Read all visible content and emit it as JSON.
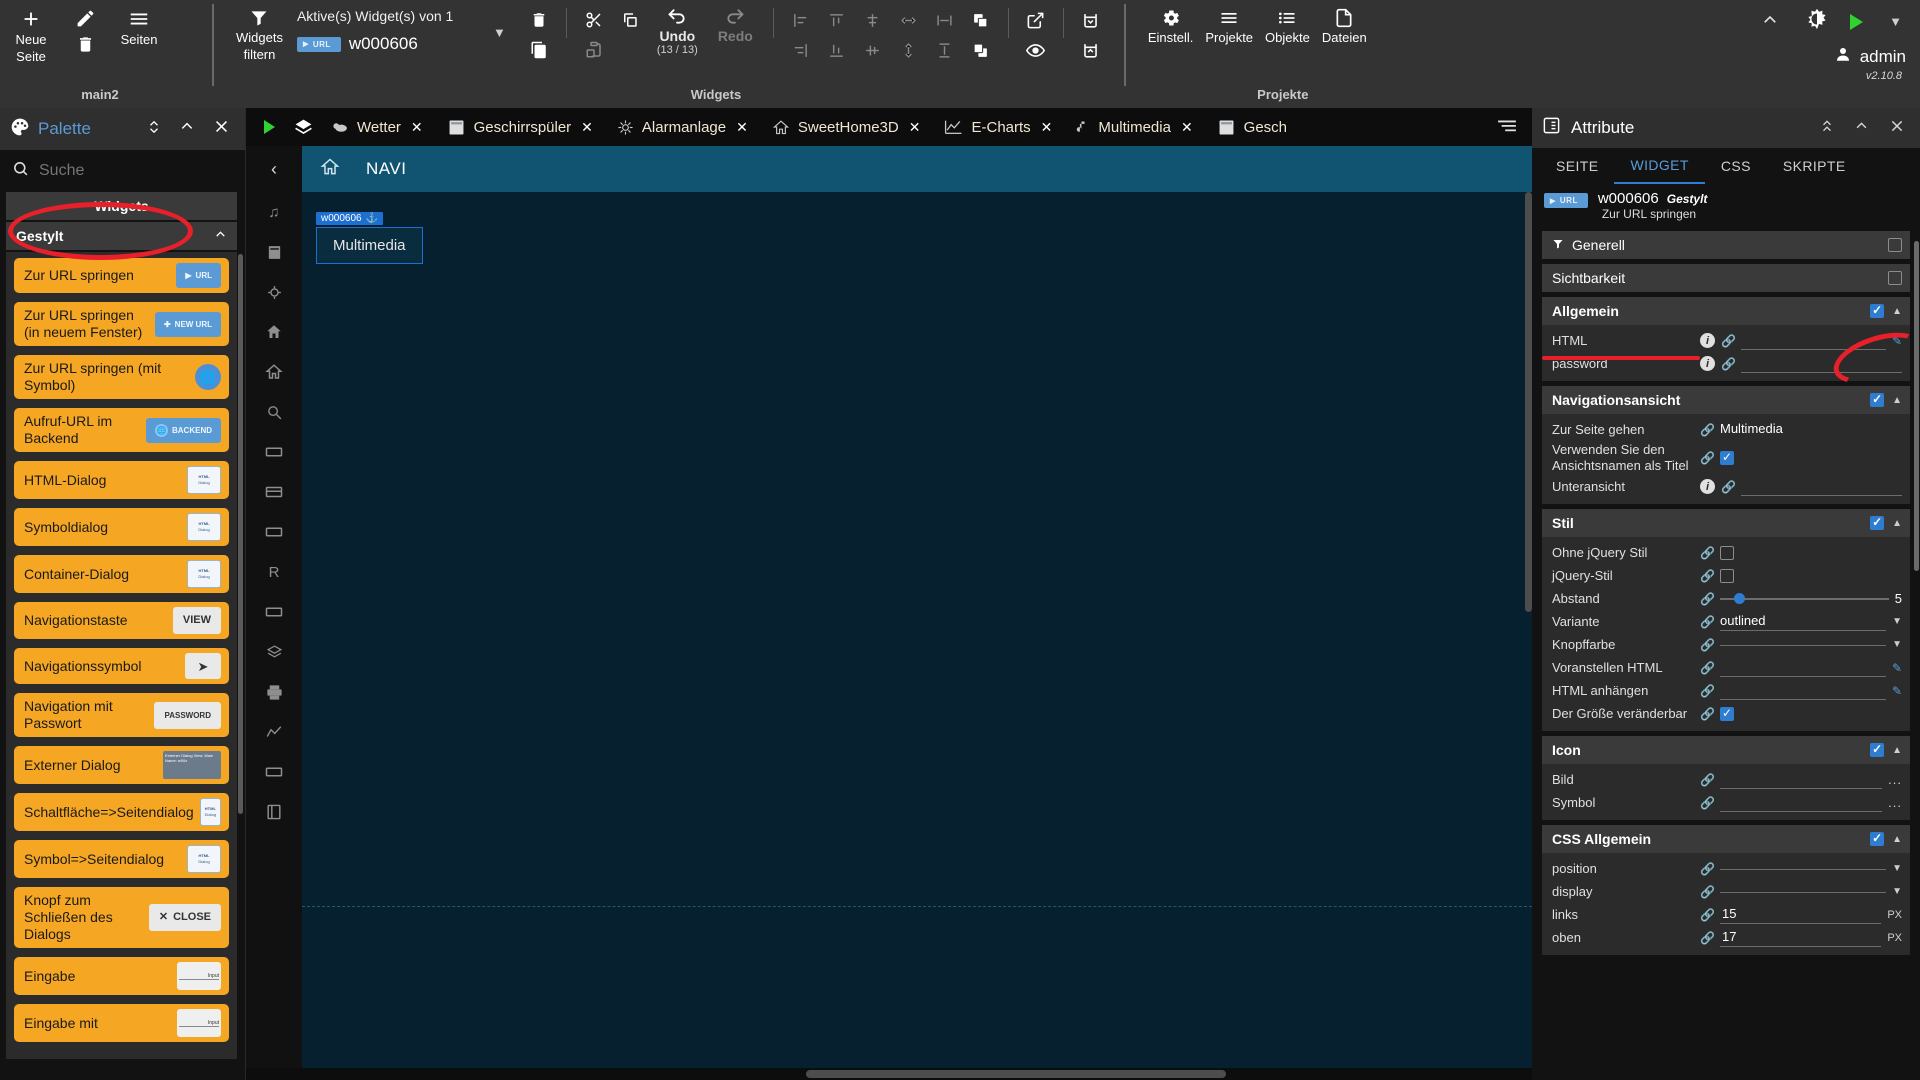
{
  "toolbar": {
    "pages_group": {
      "new_page": "Neue\nSeite",
      "new_page_line1": "Neue",
      "new_page_line2": "Seite",
      "edit_label": "",
      "pages": "Seiten",
      "group_label": "main2"
    },
    "widgets_group": {
      "filter_label_line1": "Widgets",
      "filter_label_line2": "filtern",
      "active_title": "Aktive(s) Widget(s) von 1",
      "active_widget_chip": "URL",
      "active_widget_name": "w000606",
      "undo_label": "Undo",
      "undo_count": "(13 / 13)",
      "redo_label": "Redo",
      "group_label": "Widgets"
    },
    "projects_group": {
      "settings": "Einstell.",
      "projects": "Projekte",
      "objects": "Objekte",
      "files": "Dateien",
      "group_label": "Projekte"
    },
    "top_right": {
      "user": "admin",
      "version": "v2.10.8"
    }
  },
  "palette": {
    "title": "Palette",
    "search_placeholder": "Suche",
    "search_value": "",
    "partial_category": "Widgets",
    "category": "Gestylt",
    "items": [
      {
        "label": "Zur URL springen",
        "chip_kind": "blue",
        "chip_text": "URL",
        "highlighted": true
      },
      {
        "label": "Zur URL springen (in neuem Fenster)",
        "chip_kind": "blue-new",
        "chip_text": "NEW URL"
      },
      {
        "label": "Zur URL springen (mit Symbol)",
        "chip_kind": "circle",
        "chip_text": "🌐"
      },
      {
        "label": "Aufruf-URL im Backend",
        "chip_kind": "blue-back",
        "chip_text": "BACKEND"
      },
      {
        "label": "HTML-Dialog",
        "chip_kind": "dialog",
        "chip_text": "HTML Dialog"
      },
      {
        "label": "Symboldialog",
        "chip_kind": "dialog",
        "chip_text": "HTML Dialog"
      },
      {
        "label": "Container-Dialog",
        "chip_kind": "dialog",
        "chip_text": "HTML Dialog"
      },
      {
        "label": "Navigationstaste",
        "chip_kind": "grey",
        "chip_text": "VIEW"
      },
      {
        "label": "Navigationssymbol",
        "chip_kind": "nav",
        "chip_text": "➤"
      },
      {
        "label": "Navigation mit Passwort",
        "chip_kind": "grey-sm",
        "chip_text": "PASSWORD"
      },
      {
        "label": "Externer Dialog",
        "chip_kind": "ext",
        "chip_text": "Externer Dialog View: Main Name: w00x"
      },
      {
        "label": "Schaltfläche=>Seitendialog",
        "chip_kind": "dialog",
        "chip_text": ""
      },
      {
        "label": "Symbol=>Seitendialog",
        "chip_kind": "dialog",
        "chip_text": ""
      },
      {
        "label": "Knopf zum Schließen des Dialogs",
        "chip_kind": "grey",
        "chip_text": "CLOSE"
      },
      {
        "label": "Eingabe",
        "chip_kind": "input",
        "chip_text": "Input"
      },
      {
        "label": "Eingabe mit",
        "chip_kind": "input",
        "chip_text": "Input"
      }
    ]
  },
  "editor": {
    "tabs": [
      {
        "label": "Wetter",
        "icon": "weather-icon",
        "closable": true
      },
      {
        "label": "Geschirrspüler",
        "icon": "dishwasher-icon",
        "closable": true
      },
      {
        "label": "Alarmanlage",
        "icon": "alarm-icon",
        "closable": true
      },
      {
        "label": "SweetHome3D",
        "icon": "home-icon",
        "closable": true
      },
      {
        "label": "E-Charts",
        "icon": "chart-icon",
        "closable": true
      },
      {
        "label": "Multimedia",
        "icon": "music-icon",
        "closable": true
      },
      {
        "label": "Gesch",
        "icon": "dishwasher-icon",
        "closable": false
      }
    ],
    "canvas": {
      "navi_title": "NAVI",
      "selected_widget_tag": "w000606",
      "selected_widget_label": "Multimedia"
    }
  },
  "attributes": {
    "title": "Attribute",
    "tabs": [
      {
        "label": "SEITE",
        "active": false
      },
      {
        "label": "WIDGET",
        "active": true
      },
      {
        "label": "CSS",
        "active": false
      },
      {
        "label": "SKRIPTE",
        "active": false
      }
    ],
    "widget": {
      "chip": "URL",
      "name": "w000606",
      "style_label": "Gestylt",
      "description": "Zur URL springen"
    },
    "sections": [
      {
        "name": "generell",
        "title": "Generell",
        "icon": "filter-icon",
        "checkbox": false,
        "collapsed": true,
        "rows": []
      },
      {
        "name": "sichtbarkeit",
        "title": "Sichtbarkeit",
        "checkbox": false,
        "collapsed": true,
        "rows": []
      },
      {
        "name": "allgemein",
        "title": "Allgemein",
        "checkbox": true,
        "collapsed": false,
        "rows": [
          {
            "label": "HTML",
            "info": true,
            "control": "text",
            "value": "",
            "pencil": true
          },
          {
            "label": "password",
            "info": true,
            "control": "text",
            "value": ""
          }
        ]
      },
      {
        "name": "navigationsansicht",
        "title": "Navigationsansicht",
        "checkbox": true,
        "collapsed": false,
        "annotated": true,
        "rows": [
          {
            "label": "Zur Seite gehen",
            "control": "select",
            "value": "Multimedia"
          },
          {
            "label": "Verwenden Sie den Ansichtsnamen als Titel",
            "control": "checkbox",
            "checked": true
          },
          {
            "label": "Unteransicht",
            "info": true,
            "control": "text",
            "value": ""
          }
        ]
      },
      {
        "name": "stil",
        "title": "Stil",
        "checkbox": true,
        "collapsed": false,
        "rows": [
          {
            "label": "Ohne jQuery Stil",
            "control": "checkbox",
            "checked": false
          },
          {
            "label": "jQuery-Stil",
            "control": "checkbox",
            "checked": false
          },
          {
            "label": "Abstand",
            "control": "slider",
            "value": "5"
          },
          {
            "label": "Variante",
            "control": "dropdown",
            "value": "outlined"
          },
          {
            "label": "Knopffarbe",
            "control": "dropdown",
            "value": ""
          },
          {
            "label": "Voranstellen HTML",
            "control": "text",
            "value": "",
            "pencil": true
          },
          {
            "label": "HTML anhängen",
            "control": "text",
            "value": "",
            "pencil": true
          },
          {
            "label": "Der Größe veränderbar",
            "control": "checkbox",
            "checked": true
          }
        ]
      },
      {
        "name": "icon",
        "title": "Icon",
        "checkbox": true,
        "collapsed": false,
        "rows": [
          {
            "label": "Bild",
            "control": "text",
            "value": "",
            "dots": true
          },
          {
            "label": "Symbol",
            "control": "text",
            "value": "",
            "dots": true
          }
        ]
      },
      {
        "name": "css-allgemein",
        "title": "CSS Allgemein",
        "checkbox": true,
        "collapsed": false,
        "rows": [
          {
            "label": "position",
            "control": "dropdown",
            "value": ""
          },
          {
            "label": "display",
            "control": "dropdown",
            "value": ""
          },
          {
            "label": "links",
            "control": "text",
            "value": "15",
            "unit": "PX"
          },
          {
            "label": "oben",
            "control": "text",
            "value": "17",
            "unit": "PX"
          }
        ]
      }
    ]
  }
}
